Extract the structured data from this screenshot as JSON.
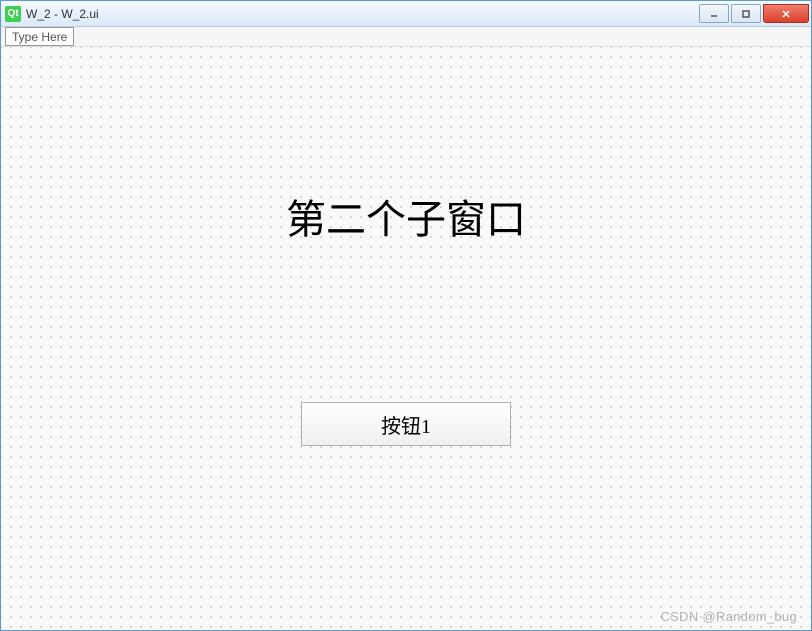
{
  "window": {
    "app_icon_label": "Qt",
    "title": "W_2 - W_2.ui"
  },
  "controls": {
    "minimize_name": "minimize",
    "maximize_name": "maximize",
    "close_name": "close"
  },
  "menubar": {
    "type_here_placeholder": "Type Here"
  },
  "form": {
    "heading": "第二个子窗口",
    "button1_label": "按钮1"
  },
  "watermark": "CSDN @Random_bug"
}
